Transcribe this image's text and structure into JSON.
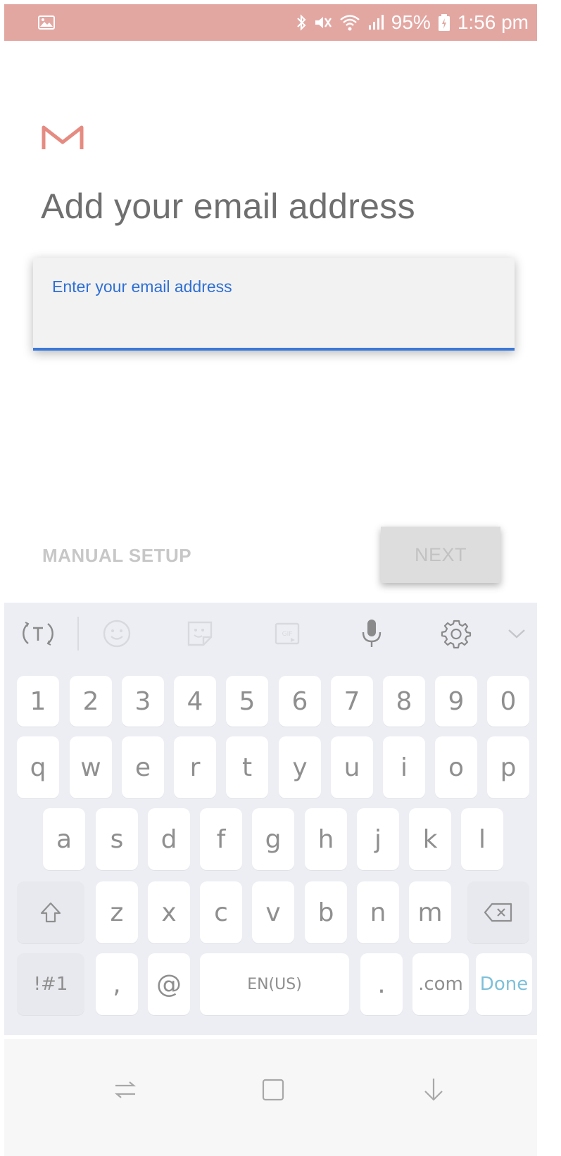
{
  "status_bar": {
    "battery": "95%",
    "time": "1:56 pm",
    "icons": [
      "gallery-notification-icon",
      "bluetooth-icon",
      "mute-icon",
      "wifi-icon",
      "signal-icon",
      "battery-icon"
    ],
    "background_color": "#e3a7a2"
  },
  "header": {
    "logo": "gmail-logo",
    "title": "Add your email address"
  },
  "email_field": {
    "placeholder": "Enter your email address",
    "value": ""
  },
  "actions": {
    "manual_setup_label": "MANUAL SETUP",
    "next_label": "NEXT"
  },
  "keyboard": {
    "toolbar_icons": [
      "text-translate-icon",
      "emoji-icon",
      "sticker-icon",
      "gif-icon",
      "microphone-icon",
      "settings-icon",
      "chevron-down-icon"
    ],
    "number_row": [
      "1",
      "2",
      "3",
      "4",
      "5",
      "6",
      "7",
      "8",
      "9",
      "0"
    ],
    "row1": [
      "q",
      "w",
      "e",
      "r",
      "t",
      "y",
      "u",
      "i",
      "o",
      "p"
    ],
    "row2": [
      "a",
      "s",
      "d",
      "f",
      "g",
      "h",
      "j",
      "k",
      "l"
    ],
    "row3": [
      "z",
      "x",
      "c",
      "v",
      "b",
      "n",
      "m"
    ],
    "symbols_label": "!#1",
    "comma_label": ",",
    "at_label": "@",
    "space_label": "EN(US)",
    "period_label": ".",
    "dotcom_label": ".com",
    "done_label": "Done"
  },
  "nav_bar": {
    "icons": [
      "recent-apps-icon",
      "home-icon",
      "back-icon"
    ]
  }
}
